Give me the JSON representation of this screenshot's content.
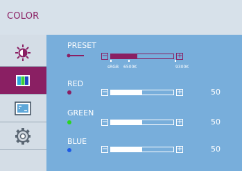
{
  "header": {
    "title": "COLOR"
  },
  "sidebar": {
    "tabs": [
      {
        "icon": "brightness-icon",
        "active": false
      },
      {
        "icon": "color-bars-icon",
        "active": true
      },
      {
        "icon": "image-position-icon",
        "active": false
      },
      {
        "icon": "settings-gear-icon",
        "active": false
      }
    ]
  },
  "controls": {
    "preset": {
      "label": "PRESET",
      "options": [
        "sRGB",
        "6500K",
        "9300K"
      ],
      "selected": "sRGB",
      "level": 0.42
    },
    "red": {
      "label": "RED",
      "value": "50",
      "level": 0.5,
      "color": "#8a1f63"
    },
    "green": {
      "label": "GREEN",
      "value": "50",
      "level": 0.5,
      "color": "#2ad61f"
    },
    "blue": {
      "label": "BLUE",
      "value": "50",
      "level": 0.5,
      "color": "#1e5be6"
    }
  },
  "colors": {
    "accent": "#8a1f63",
    "panel": "#78aedb",
    "sidebar": "#d4dde6"
  }
}
